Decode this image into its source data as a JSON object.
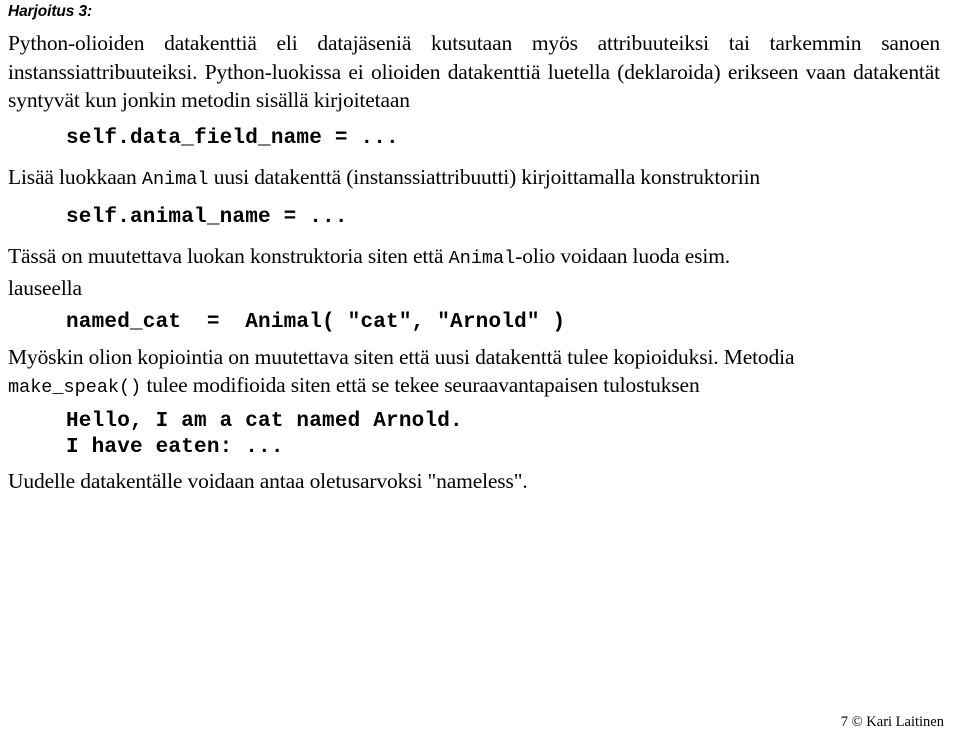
{
  "document": {
    "heading": "Harjoitus 3:",
    "paragraph_1": {
      "text": "Python-olioiden datakenttiä eli datajäseniä kutsutaan myös attribuuteiksi tai tarkemmin sanoen instanssiattribuuteiksi. Python-luokissa ei olioiden datakenttiä luetella (deklaroida) erikseen vaan datakentät syntyvät kun jonkin metodin sisällä kirjoitetaan",
      "line_1": "Python-olioiden datakenttiä eli datajäseniä kutsutaan myös attribuuteiksi tai tarkemmin",
      "line_2": "sanoen instanssiattribuuteiksi. Python-luokissa ei olioiden datakenttiä luetella (deklaroida)",
      "line_3": "erikseen vaan datakentät syntyvät kun jonkin metodin sisällä kirjoitetaan"
    },
    "code_1": "self.data_field_name = ...",
    "paragraph_2": {
      "before_code": "Lisää luokkaan ",
      "code_term": "Animal",
      "after_code": " uusi datakenttä (instanssiattribuutti) kirjoittamalla konstruktoriin"
    },
    "code_2": "self.animal_name = ...",
    "paragraph_3": {
      "before_code": "Tässä on muutettava luokan konstruktoria siten että ",
      "code_term": "Animal",
      "after_code": "-olio voidaan luoda esim.",
      "line_2": "lauseella"
    },
    "code_3": "named_cat  =  Animal( \"cat\", \"Arnold\" )",
    "paragraph_4": {
      "line_1": "Myöskin olion kopiointia on muutettava siten että uusi datakenttä tulee kopioiduksi. Metodia",
      "code_term": "make_speak()",
      "after_code": " tulee modifioida siten että se tekee seuraavantapaisen tulostuksen"
    },
    "code_output_1": "Hello, I am a cat named Arnold.",
    "code_output_2": "I have eaten: ...",
    "paragraph_5": "Uudelle datakentälle voidaan antaa oletusarvoksi \"nameless\".",
    "footer": "7 © Kari Laitinen"
  }
}
